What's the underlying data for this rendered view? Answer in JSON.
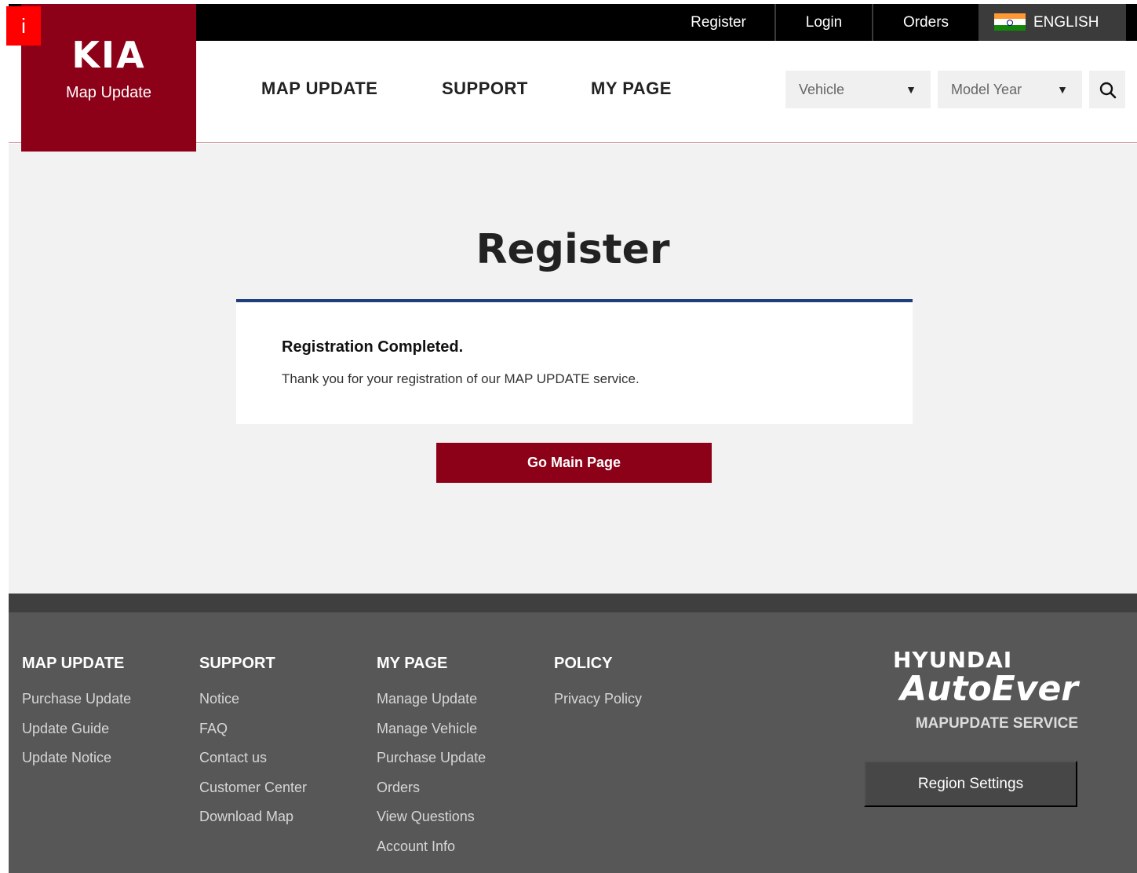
{
  "badge": "i",
  "topbar": {
    "register": "Register",
    "login": "Login",
    "orders": "Orders",
    "language": "ENGLISH"
  },
  "logo": {
    "brand": "KIA",
    "subtitle": "Map Update"
  },
  "nav": {
    "items": [
      "MAP UPDATE",
      "SUPPORT",
      "MY PAGE"
    ]
  },
  "filters": {
    "vehicle": "Vehicle",
    "model_year": "Model Year"
  },
  "main": {
    "title": "Register",
    "card_title": "Registration Completed.",
    "card_text": "Thank you for your registration of our MAP UPDATE service.",
    "button": "Go Main Page"
  },
  "footer": {
    "columns": [
      {
        "heading": "MAP UPDATE",
        "links": [
          "Purchase Update",
          "Update Guide",
          "Update Notice"
        ]
      },
      {
        "heading": "SUPPORT",
        "links": [
          "Notice",
          "FAQ",
          "Contact us",
          "Customer Center",
          "Download Map"
        ]
      },
      {
        "heading": "MY PAGE",
        "links": [
          "Manage Update",
          "Manage Vehicle",
          "Purchase Update",
          "Orders",
          "View Questions",
          "Account Info"
        ]
      },
      {
        "heading": "POLICY",
        "links": [
          "Privacy Policy"
        ]
      }
    ],
    "brand_top": "HYUNDAI",
    "brand_main": "AutoEver",
    "brand_service": "MAPUPDATE SERVICE",
    "region_button": "Region Settings"
  },
  "colors": {
    "brand_red": "#8c0018",
    "card_accent": "#1f3f7a",
    "topbar": "#000000",
    "footer": "#575757"
  }
}
